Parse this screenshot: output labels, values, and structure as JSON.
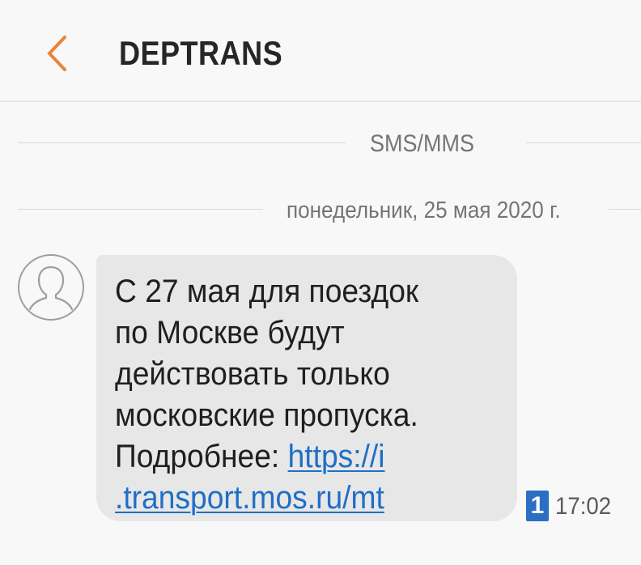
{
  "header": {
    "title": "DEPTRANS",
    "back_icon": "chevron-left-icon",
    "accent_color": "#e8833a"
  },
  "separators": {
    "channel": "SMS/MMS",
    "date": "понедельник, 25 мая 2020 г."
  },
  "message": {
    "avatar_icon": "person-avatar-icon",
    "lines": [
      "С 27 мая для поездок",
      "по Москве будут",
      "действовать только",
      "московские пропуска."
    ],
    "link_prefix": "Подробнее: ",
    "link_part1": "https://i",
    "link_part2": ".transport.mos.ru/mt",
    "sim": "1",
    "time": "17:02",
    "link_color": "#1e6fc6",
    "sim_color": "#2a6fc1"
  }
}
